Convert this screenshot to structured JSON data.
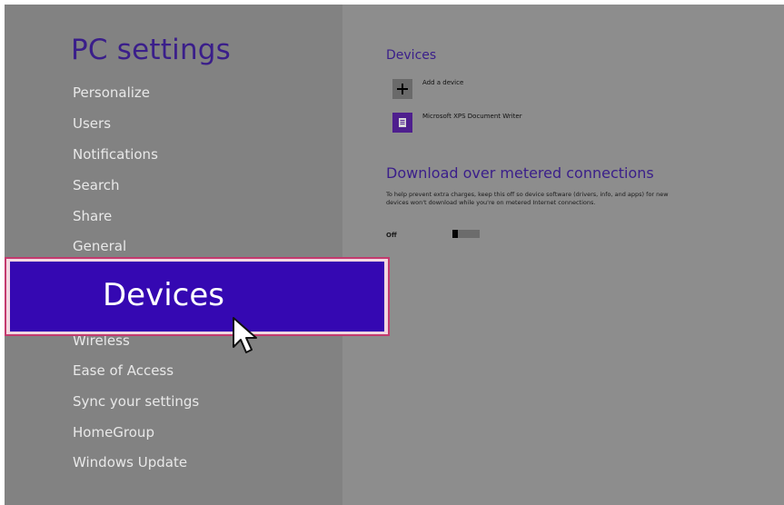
{
  "sidebar": {
    "title": "PC settings",
    "items": [
      {
        "label": "Personalize"
      },
      {
        "label": "Users"
      },
      {
        "label": "Notifications"
      },
      {
        "label": "Search"
      },
      {
        "label": "Share"
      },
      {
        "label": "General"
      },
      {
        "label": "Devices"
      },
      {
        "label": "Wireless"
      },
      {
        "label": "Ease of Access"
      },
      {
        "label": "Sync your settings"
      },
      {
        "label": "HomeGroup"
      },
      {
        "label": "Windows Update"
      }
    ],
    "selected": "Devices"
  },
  "main": {
    "devices_heading": "Devices",
    "add_device_label": "Add a device",
    "add_device_icon": "plus-icon",
    "devices": [
      {
        "name": "Microsoft XPS Document Writer",
        "icon": "printer-document-icon"
      }
    ],
    "metered": {
      "heading": "Download over metered connections",
      "description": "To help prevent extra charges, keep this off so device software (drivers, info, and apps) for new devices won't download while you're on metered Internet connections.",
      "state_label": "Off",
      "toggle_on": false
    }
  },
  "colors": {
    "accent": "#3508b2",
    "heading": "#3a1e8a",
    "highlight_border": "#c33a6e",
    "background": "#8c8c8c"
  }
}
